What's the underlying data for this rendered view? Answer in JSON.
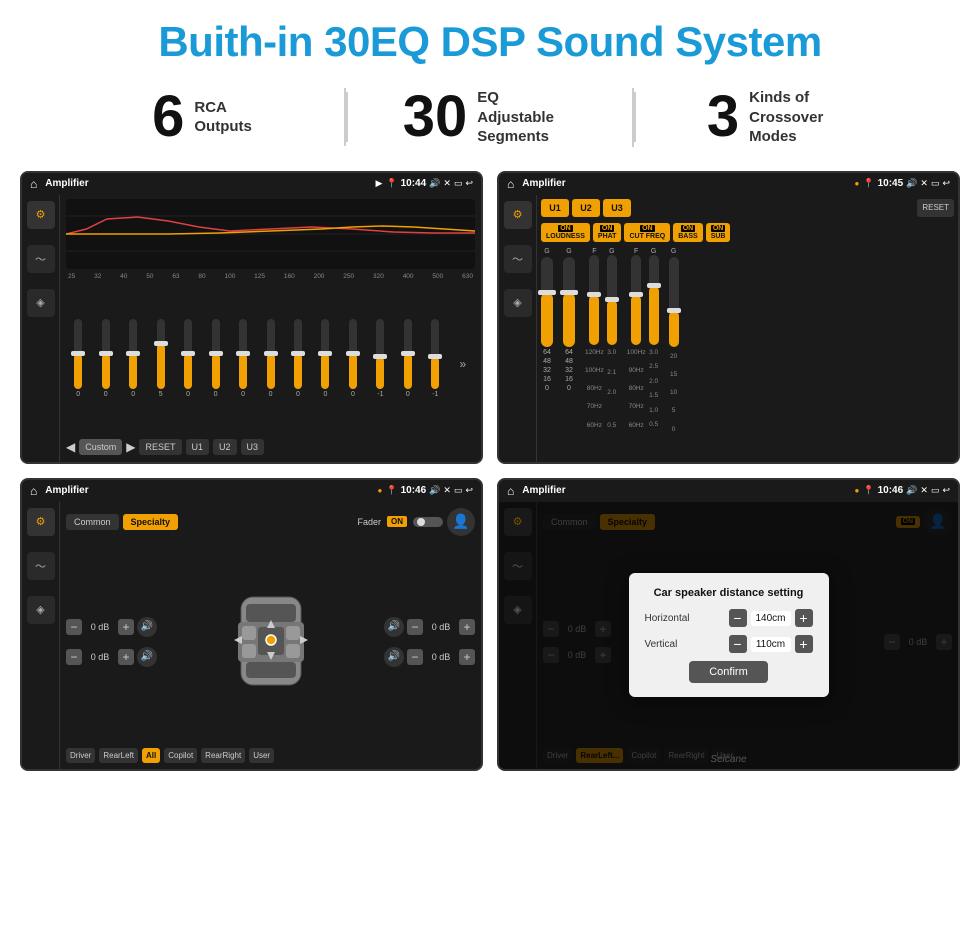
{
  "header": {
    "title": "Buith-in 30EQ DSP Sound System"
  },
  "stats": [
    {
      "number": "6",
      "label": "RCA\nOutputs"
    },
    {
      "number": "30",
      "label": "EQ Adjustable\nSegments"
    },
    {
      "number": "3",
      "label": "Kinds of\nCrossover Modes"
    }
  ],
  "screens": {
    "top_left": {
      "status_bar": {
        "title": "Amplifier",
        "time": "10:44"
      },
      "eq_freqs": [
        "25",
        "32",
        "40",
        "50",
        "63",
        "80",
        "100",
        "125",
        "160",
        "200",
        "250",
        "320",
        "400",
        "500",
        "630"
      ],
      "eq_values": [
        "0",
        "0",
        "0",
        "5",
        "0",
        "0",
        "0",
        "0",
        "0",
        "0",
        "0",
        "-1",
        "0",
        "-1"
      ],
      "bottom_buttons": [
        "Custom",
        "RESET",
        "U1",
        "U2",
        "U3"
      ]
    },
    "top_right": {
      "status_bar": {
        "title": "Amplifier",
        "time": "10:45"
      },
      "channels": [
        "U1",
        "U2",
        "U3"
      ],
      "toggles": [
        "LOUDNESS",
        "PHAT",
        "CUT FREQ",
        "BASS",
        "SUB"
      ],
      "reset_label": "RESET"
    },
    "bottom_left": {
      "status_bar": {
        "title": "Amplifier",
        "time": "10:46"
      },
      "tabs": [
        "Common",
        "Specialty"
      ],
      "fader_label": "Fader",
      "fader_on": "ON",
      "vol_values": [
        "0 dB",
        "0 dB",
        "0 dB",
        "0 dB"
      ],
      "position_buttons": [
        "Driver",
        "RearLeft",
        "All",
        "Copilot",
        "RearRight",
        "User"
      ]
    },
    "bottom_right": {
      "status_bar": {
        "title": "Amplifier",
        "time": "10:46"
      },
      "tabs": [
        "Common",
        "Specialty"
      ],
      "modal": {
        "title": "Car speaker distance setting",
        "horizontal_label": "Horizontal",
        "horizontal_value": "140cm",
        "vertical_label": "Vertical",
        "vertical_value": "110cm",
        "confirm_label": "Confirm"
      },
      "vol_values": [
        "0 dB",
        "0 dB"
      ],
      "position_buttons": [
        "Driver",
        "RearLeft",
        "Copilot",
        "RearRight",
        "User"
      ]
    }
  },
  "watermark": "Seicane"
}
